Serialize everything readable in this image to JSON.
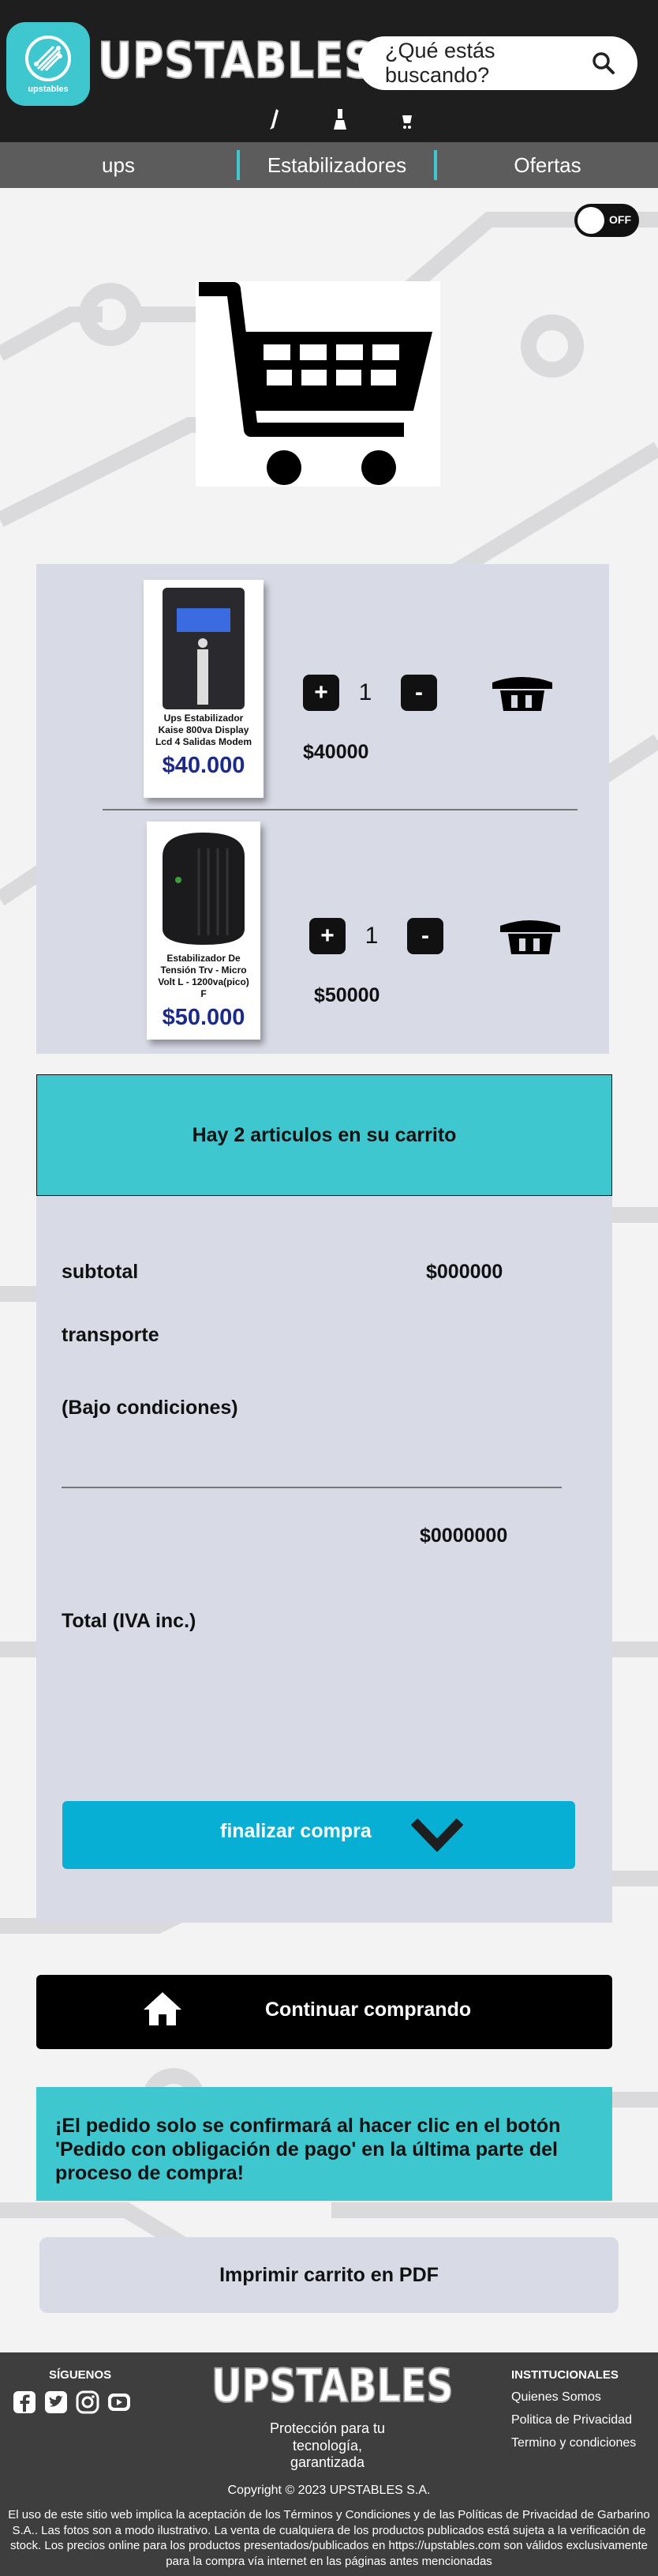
{
  "colors": {
    "accent": "#3ec7cf",
    "header_bg": "#1e1e1e",
    "nav_bg": "#5c5c5c",
    "panel_bg": "#d8dae6",
    "price_blue": "#1c2a8a",
    "finalize_bg": "#08afd4"
  },
  "header": {
    "logo_small_text": "upstables",
    "brand": "UPSTABLES",
    "search_placeholder": "¿Qué estás buscando?",
    "search_icon": "search-icon"
  },
  "nav": {
    "items": [
      "ups",
      "Estabilizadores",
      "Ofertas"
    ]
  },
  "toggle": {
    "label": "OFF"
  },
  "cart": {
    "items": [
      {
        "name": "Ups Estabilizador Kaise 800va Display Lcd 4 Salidas Modem",
        "price": "$40.000",
        "qty": "1",
        "total": "$40000"
      },
      {
        "name": "Estabilizador De Tensión Trv - Micro Volt L - 1200va(pico) F",
        "price": "$50.000",
        "qty": "1",
        "total": "$50000"
      }
    ],
    "plus": "+",
    "minus": "-"
  },
  "summary": {
    "count_text": "Hay 2 articulos en su carrito",
    "subtotal_label": "subtotal",
    "subtotal_value": "$000000",
    "transport_label": "transporte",
    "conditions_label": "(Bajo condiciones)",
    "total_value": "$0000000",
    "total_label": "Total (IVA inc.)",
    "finalize_label": "finalizar compra"
  },
  "continue_label": "Continuar comprando",
  "notice": "¡El pedido solo se confirmará al hacer clic en el botón 'Pedido con obligación de pago' en la última parte del proceso de compra!",
  "pdf_label": "Imprimir carrito en PDF",
  "footer": {
    "follow": "SÍGUENOS",
    "brand": "UPSTABLES",
    "tagline": "Protección para tu tecnología, garantizada",
    "institutional": "INSTITUCIONALES",
    "links": [
      "Quienes Somos",
      "Politica de Privacidad",
      "Termino y condiciones"
    ],
    "copyright": "Copyright © 2023 UPSTABLES S.A.",
    "legal": "El uso de este sitio web implica la aceptación de los Términos y Condiciones y de las Políticas de Privacidad de Garbarino S.A.. Las fotos son a modo ilustrativo. La venta de cualquiera de los productos publicados está sujeta a la verificación de stock. Los precios online para los productos presentados/publicados en https://upstables.com son válidos exclusivamente para la compra vía internet en las páginas antes mencionadas"
  }
}
